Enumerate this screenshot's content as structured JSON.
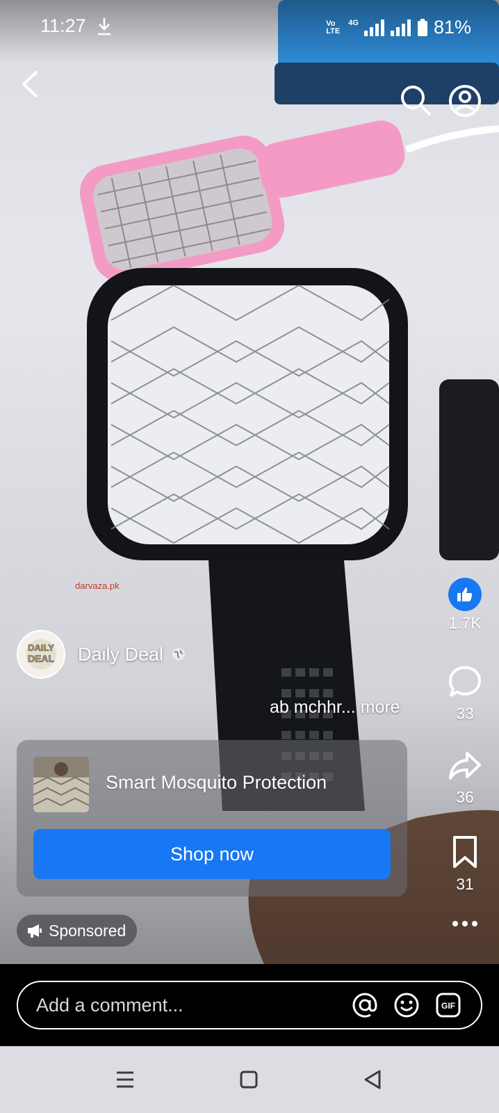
{
  "status_bar": {
    "time": "11:27",
    "network": "4G",
    "volte": "Vo LTE",
    "battery": "81%"
  },
  "top_nav": {
    "back_icon": "chevron-left-icon",
    "search_icon": "search-icon",
    "profile_icon": "profile-icon"
  },
  "video": {
    "watermark": "darvaza.pk"
  },
  "rail": {
    "likes": "1.7K",
    "comments": "33",
    "shares": "36",
    "saves": "31",
    "more_icon": "more-horizontal-icon"
  },
  "author": {
    "name": "Daily Deal",
    "avatar_text_top": "DAILY",
    "avatar_text_bottom": "DEAL"
  },
  "caption": "ab mchhr... more",
  "ad": {
    "title": "Smart Mosquito Protection",
    "cta": "Shop now"
  },
  "sponsored_label": "Sponsored",
  "comment": {
    "placeholder": "Add a comment..."
  },
  "colors": {
    "accent": "#1877f2",
    "nav_bar": "#dcdde2"
  }
}
